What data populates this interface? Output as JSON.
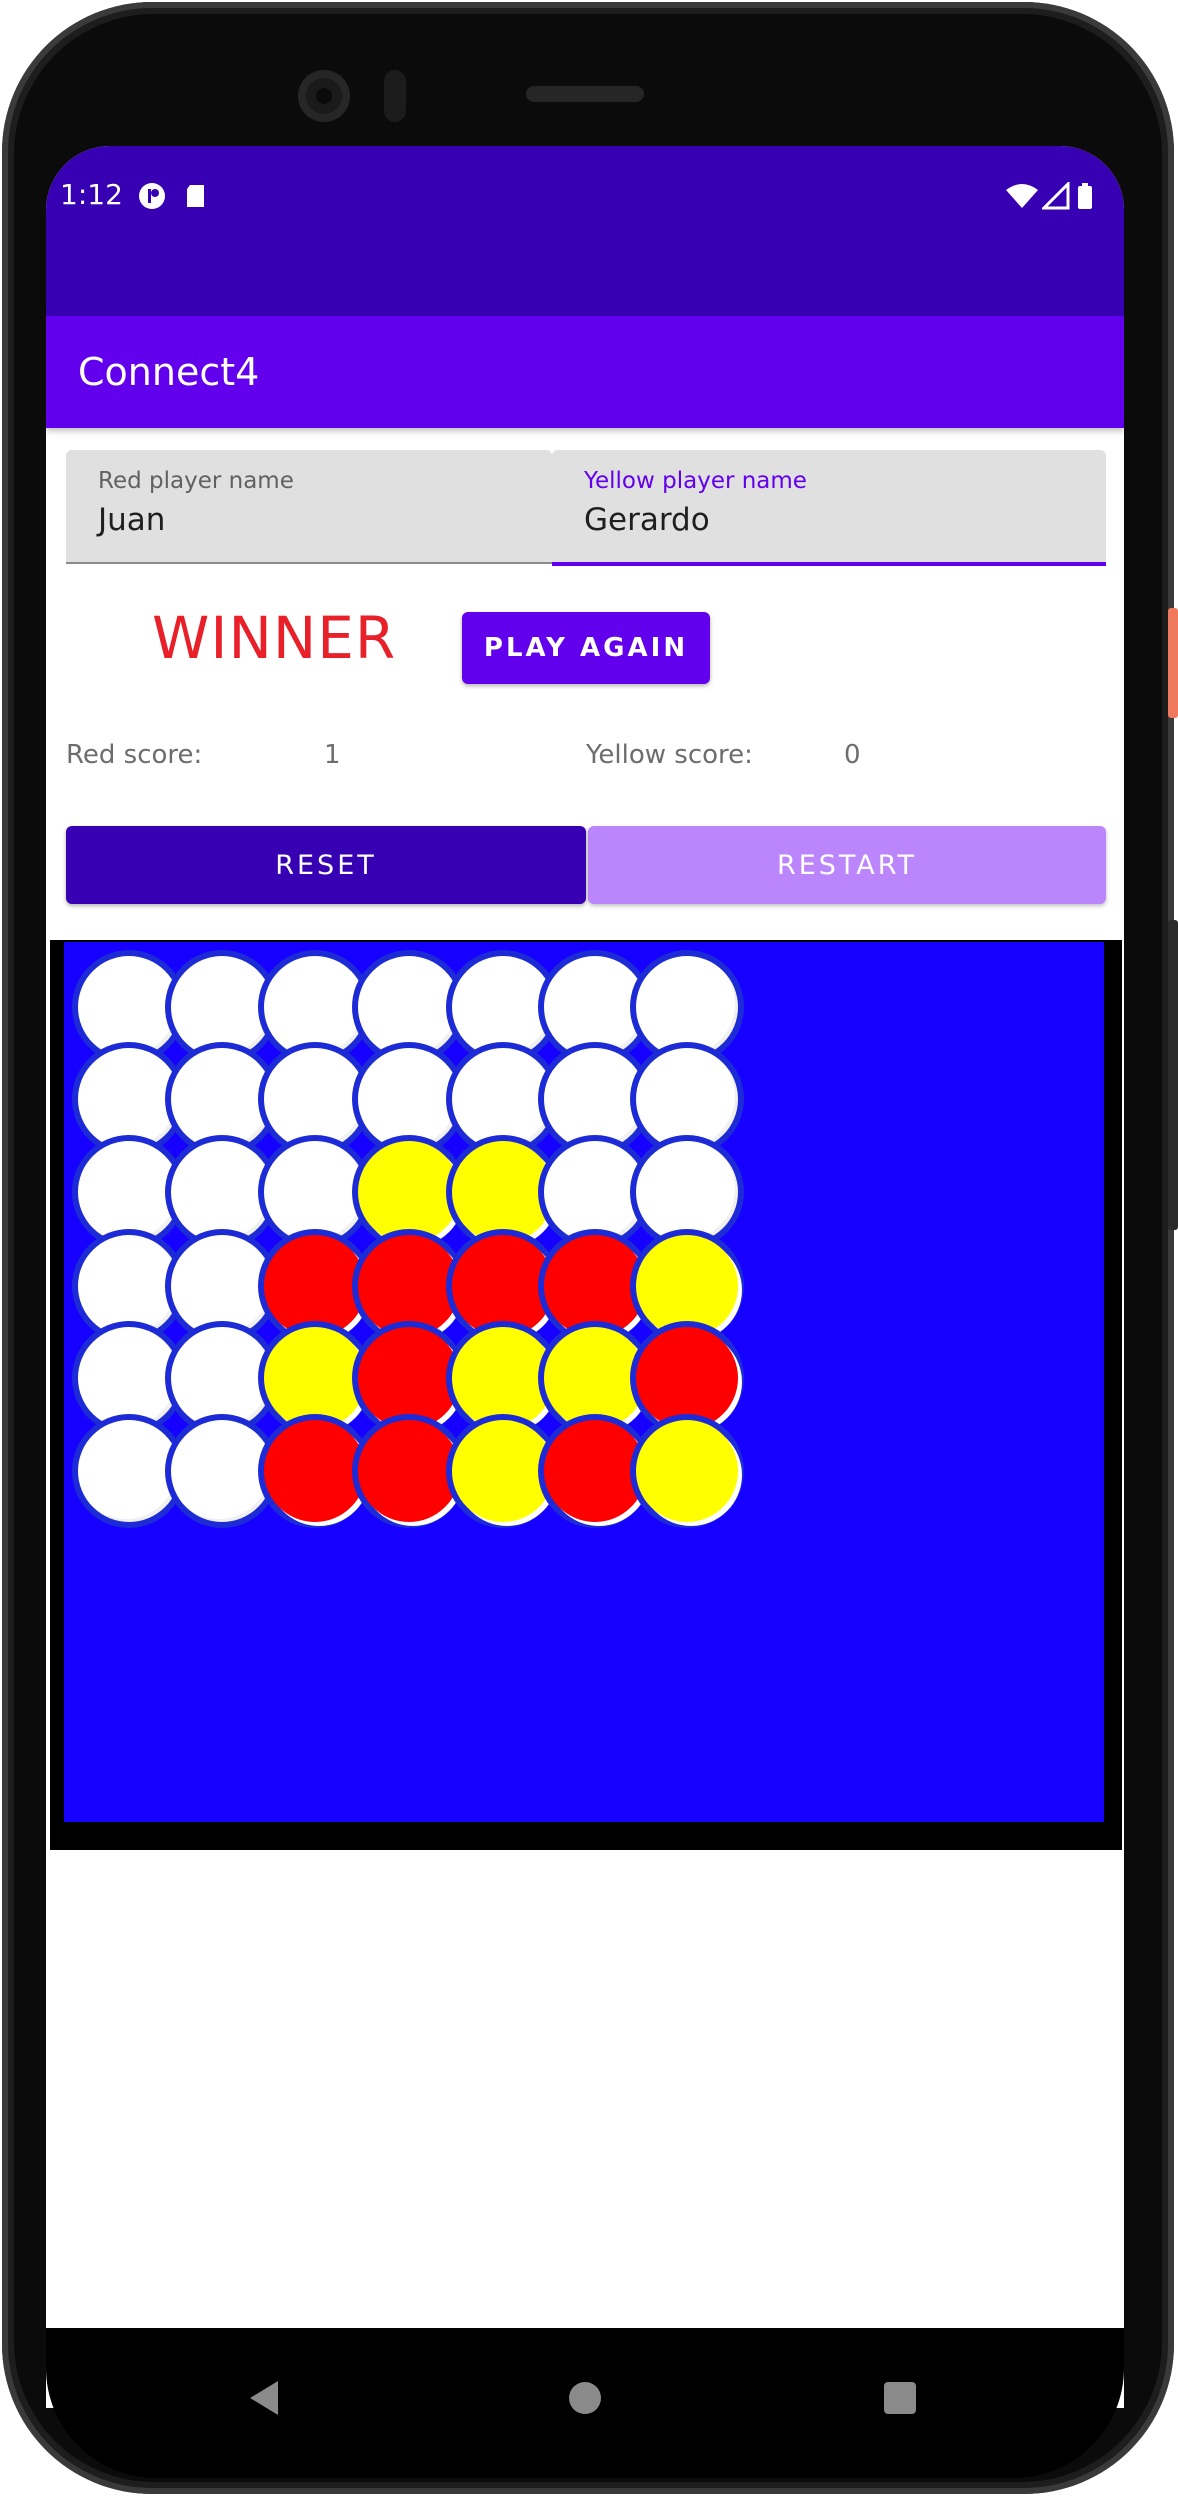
{
  "status_bar": {
    "time": "1:12"
  },
  "app": {
    "title": "Connect4"
  },
  "inputs": {
    "red_player": {
      "label": "Red player name",
      "value": "Juan"
    },
    "yellow_player": {
      "label": "Yellow player name",
      "value": "Gerardo"
    }
  },
  "result": {
    "winner_text": "WINNER",
    "play_again_label": "PLAY AGAIN"
  },
  "scores": {
    "red_label": "Red score:",
    "red_value": "1",
    "yellow_label": "Yellow score:",
    "yellow_value": "0"
  },
  "actions": {
    "reset_label": "RESET",
    "restart_label": "RESTART"
  },
  "colors": {
    "primary": "#6200ee",
    "primary_dark": "#3700b3",
    "restart_bg": "#bb86fc",
    "winner": "#e8202a",
    "board": "#1600ff"
  },
  "board": {
    "rows": 6,
    "columns": 7,
    "cells": [
      [
        "empty",
        "empty",
        "empty",
        "empty",
        "empty",
        "empty",
        "empty"
      ],
      [
        "empty",
        "empty",
        "empty",
        "empty",
        "empty",
        "empty",
        "empty"
      ],
      [
        "empty",
        "empty",
        "empty",
        "yellow",
        "yellow",
        "empty",
        "empty"
      ],
      [
        "empty",
        "empty",
        "red",
        "red",
        "red",
        "red",
        "yellow"
      ],
      [
        "empty",
        "empty",
        "yellow",
        "red",
        "yellow",
        "yellow",
        "red"
      ],
      [
        "empty",
        "empty",
        "red",
        "red",
        "yellow",
        "red",
        "yellow"
      ]
    ]
  },
  "nav": {
    "back_icon": "back-triangle-icon",
    "home_icon": "home-circle-icon",
    "recents_icon": "recents-square-icon"
  }
}
